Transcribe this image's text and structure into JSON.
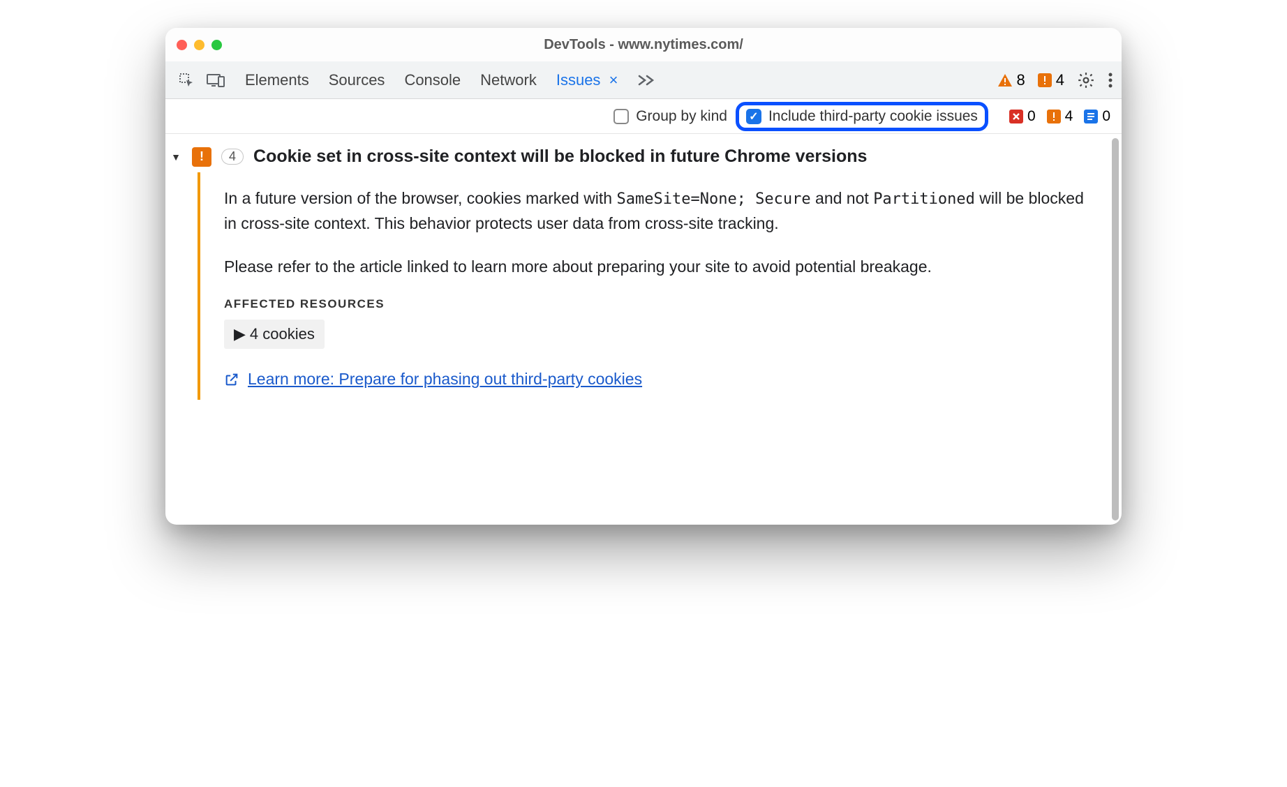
{
  "window": {
    "title": "DevTools - www.nytimes.com/"
  },
  "tabs": {
    "items": [
      "Elements",
      "Sources",
      "Console",
      "Network",
      "Issues"
    ],
    "active": "Issues"
  },
  "top_counts": {
    "warnings": 8,
    "issues": 4
  },
  "filter": {
    "group_by_kind": {
      "label": "Group by kind",
      "checked": false
    },
    "include_third_party": {
      "label": "Include third-party cookie issues",
      "checked": true
    }
  },
  "category_counts": {
    "page_errors": 0,
    "breaking_changes": 4,
    "improvements": 0
  },
  "issue": {
    "count": 4,
    "title": "Cookie set in cross-site context will be blocked in future Chrome versions",
    "para1_a": "In a future version of the browser, cookies marked with ",
    "para1_code1": "SameSite=None; Secure",
    "para1_b": " and not ",
    "para1_code2": "Partitioned",
    "para1_c": " will be blocked in cross-site context. This behavior protects user data from cross-site tracking.",
    "para2": "Please refer to the article linked to learn more about preparing your site to avoid potential breakage.",
    "affected_label": "AFFECTED RESOURCES",
    "affected_item": "4 cookies",
    "learn_label": "Learn more: Prepare for phasing out third-party cookies"
  }
}
